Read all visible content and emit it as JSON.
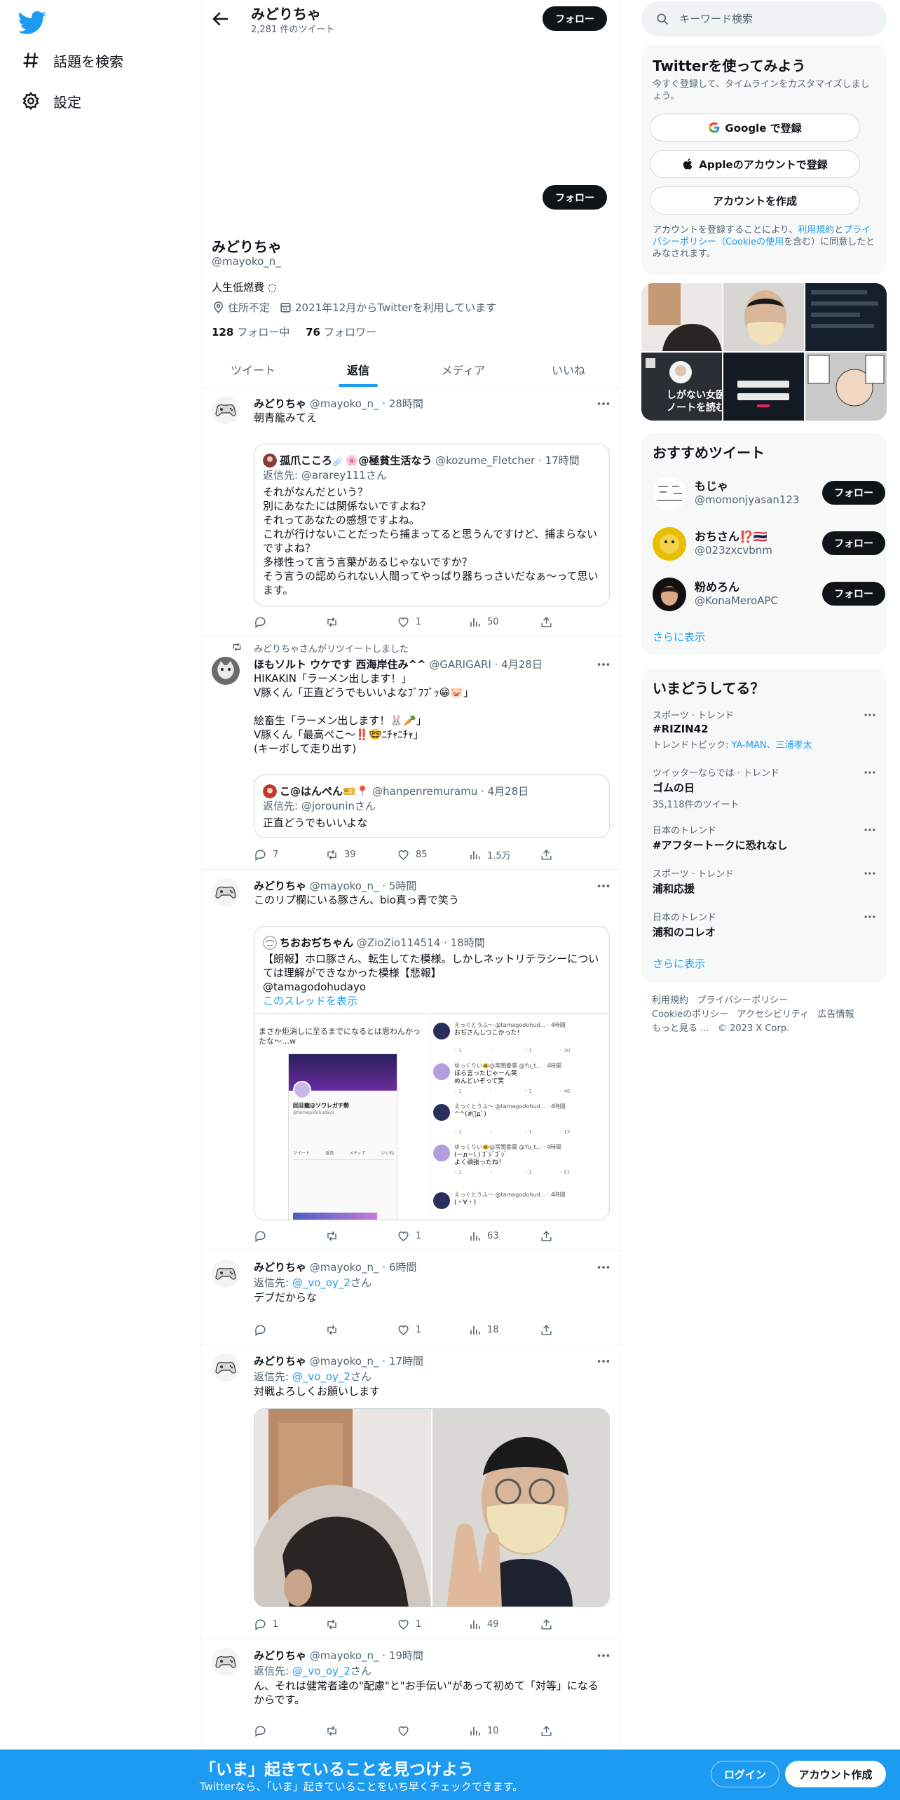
{
  "nav": {
    "explore": "話題を検索",
    "settings": "設定"
  },
  "topbar": {
    "name": "みどりちゃ",
    "tweet_count": "2,281 件のツイート",
    "follow": "フォロー"
  },
  "profile": {
    "follow": "フォロー",
    "name": "みどりちゃ",
    "handle": "@mayoko_n_",
    "bio": "人生低燃費 ◌",
    "location": "住所不定",
    "joined": "2021年12月からTwitterを利用しています",
    "following_count": "128",
    "following_label": "フォロー中",
    "followers_count": "76",
    "followers_label": "フォロワー"
  },
  "tabs": [
    "ツイート",
    "返信",
    "メディア",
    "いいね"
  ],
  "tweets": [
    {
      "name": "みどりちゃ",
      "handle": "@mayoko_n_",
      "time": "· 28時間",
      "text": "朝青龍みてえ",
      "quote": {
        "name": "孤爪こころ☄️🌸@極貧生活なう",
        "handle": "@kozume_Fletcher",
        "time": "· 17時間",
        "reply_prefix": "返信先: ",
        "reply_to": "@ararey111さん",
        "text": "それがなんだという？\n別にあなたには関係ないですよね？\nそれってあなたの感想ですよね。\nこれが行けないことだったら捕まってると思うんですけど、捕まらないですよね？\n多様性って言う言葉があるじゃないですか？\nそう言うの認められない人間ってやっぱり器ちっさいだなぁ〜って思います。"
      },
      "replies": "",
      "retweets": "",
      "likes": "1",
      "views": "50"
    },
    {
      "retweeted_by": "みどりちゃさんがリツイートしました",
      "name": "ほもソルト ウケです 西海岸住み^^",
      "handle": "@GARIGARI",
      "time": "· 4月28日",
      "text": "HIKAKIN「ラーメン出します！」\nV豚くん「正直どうでもいいよなﾌﾞﾌﾌﾞｯ😁🐷」\n\n絵畜生「ラーメン出します！🐰🥕」\nV豚くん「最高ぺこ〜‼️🤓ﾆﾁｬﾆﾁｬ」\n(キーボして走り出す)",
      "quote": {
        "name": "こ@はんぺん🎫📍",
        "handle": "@hanpenremuramu",
        "time": "· 4月28日",
        "reply_prefix": "返信先: ",
        "reply_to": "@jorouninさん",
        "text": "正直どうでもいいよな"
      },
      "replies": "7",
      "retweets": "39",
      "likes": "85",
      "views": "1.5万"
    },
    {
      "name": "みどりちゃ",
      "handle": "@mayoko_n_",
      "time": "· 5時間",
      "text": "このリプ欄にいる豚さん、bio真っ青で笑う",
      "quote": {
        "name": "ちおおぢちゃん",
        "handle": "@ZioZio114514",
        "time": "· 18時間",
        "text": "【朗報】ホロ豚さん、転生してた模様。しかしネットリテラシーについては理解ができなかった模様【悲報】\n@tamagodohudayo",
        "thread_link": "このスレッドを表示",
        "image_caption": "まさか炬消しに至るまでになるとは思わんかったな〜…w",
        "shot_profile": {
          "name": "回旦龍@ソワレガチ勢",
          "handle": "@tamagodohudayo",
          "tabs": [
            "ツイート",
            "返信",
            "メディア",
            "いいね"
          ]
        },
        "replies": [
          {
            "name": "えっぐとうふ〜",
            "handle": "@tamagodohud...",
            "time": "· 4時間",
            "text": "おぢさんしつこかった！",
            "stats": [
              "1",
              "",
              "1",
              "30"
            ]
          },
          {
            "name": "ゆっくりい🐠@常闇眷属",
            "handle": "@Yu_t...",
            "time": "· 4時間",
            "text": "ほら言ったじゃーん笑\nめんどいぞって笑",
            "stats": [
              "1",
              "",
              "1",
              "46"
            ]
          },
          {
            "name": "えっぐとうふ〜",
            "handle": "@tamagodohud...",
            "time": "· 4時間",
            "text": "^^(#ﾟдﾟ)",
            "stats": [
              "1",
              "",
              "1",
              "13"
            ]
          },
          {
            "name": "ゆっくりい🐠@常闇眷属",
            "handle": "@Yu_t...",
            "time": "· 4時間",
            "text": "(ーдー\\ ) ｺﾞｼﾞｺﾞｼﾞ\nよく頑張ったね！",
            "stats": [
              "1",
              "",
              "1",
              "57"
            ]
          },
          {
            "name": "えっぐとうふ〜",
            "handle": "@tamagodohud...",
            "time": "· 4時間",
            "text": "(・∀・)",
            "stats": []
          }
        ]
      },
      "replies": "",
      "retweets": "",
      "likes": "1",
      "views": "63"
    },
    {
      "name": "みどりちゃ",
      "handle": "@mayoko_n_",
      "time": "· 6時間",
      "reply_prefix": "返信先: ",
      "reply_to": "@_vo_oy_2",
      "reply_suffix": "さん",
      "text": "デブだからな",
      "replies": "",
      "retweets": "",
      "likes": "1",
      "views": "18"
    },
    {
      "name": "みどりちゃ",
      "handle": "@mayoko_n_",
      "time": "· 17時間",
      "reply_prefix": "返信先: ",
      "reply_to": "@_vo_oy_2",
      "reply_suffix": "さん",
      "text": "対戦よろしくお願いします",
      "replies": "1",
      "retweets": "",
      "likes": "1",
      "views": "49"
    },
    {
      "name": "みどりちゃ",
      "handle": "@mayoko_n_",
      "time": "· 19時間",
      "reply_prefix": "返信先: ",
      "reply_to": "@_vo_oy_2",
      "reply_suffix": "さん",
      "text": "ん、それは健常者達の\"配慮\"と\"お手伝い\"があって初めて「対等」になるからです。",
      "replies": "",
      "retweets": "",
      "likes": "",
      "views": "10"
    }
  ],
  "right": {
    "search_placeholder": "キーワード検索",
    "signup": {
      "title": "Twitterを使ってみよう",
      "desc": "今すぐ登録して、タイムラインをカスタマイズしましょう。",
      "google": "Google で登録",
      "apple": "Appleのアカウントで登録",
      "create": "アカウントを作成",
      "terms_1": "アカウントを登録することにより、",
      "terms_link1": "利用規約",
      "terms_2": "と",
      "terms_link2": "プライバシーポリシー（Cookieの使用",
      "terms_3": "を含む）に同意したとみなされます。"
    },
    "media_overlay": "しがない女医\nノートを読む",
    "recommended": {
      "title": "おすすめツイート",
      "users": [
        {
          "name": "もじゃ",
          "handle": "@momonjyasan123",
          "follow": "フォロー"
        },
        {
          "name": "おちさん⁉️🇹🇭",
          "handle": "@023zxcvbnm",
          "follow": "フォロー"
        },
        {
          "name": "粉めろん",
          "handle": "@KonaMeroAPC",
          "follow": "フォロー"
        }
      ],
      "more": "さらに表示"
    },
    "trends": {
      "title": "いまどうしてる？",
      "items": [
        {
          "category": "スポーツ · トレンド",
          "title": "#RIZIN42",
          "sub_prefix": "トレンドトピック: ",
          "sub_links": "YA-MAN、三浦孝太"
        },
        {
          "category": "ツイッターならでは · トレンド",
          "title": "ゴムの日",
          "sub": "35,118件のツイート"
        },
        {
          "category": "日本のトレンド",
          "title": "#アフタートークに恐れなし"
        },
        {
          "category": "スポーツ · トレンド",
          "title": "浦和応援"
        },
        {
          "category": "日本のトレンド",
          "title": "浦和のコレオ"
        }
      ],
      "more": "さらに表示"
    },
    "footer": [
      "利用規約",
      "プライバシーポリシー",
      "Cookieのポリシー",
      "アクセシビリティ",
      "広告情報",
      "もっと見る ...",
      "© 2023 X Corp."
    ]
  },
  "banner": {
    "title": "「いま」起きていることを見つけよう",
    "sub": "Twitterなら、「いま」起きていることをいち早くチェックできます。",
    "login": "ログイン",
    "signup": "アカウント作成"
  },
  "colors": {
    "accent": "#1d9bf0",
    "text": "#0f1419",
    "muted": "#536471",
    "border": "#eff3f4"
  }
}
